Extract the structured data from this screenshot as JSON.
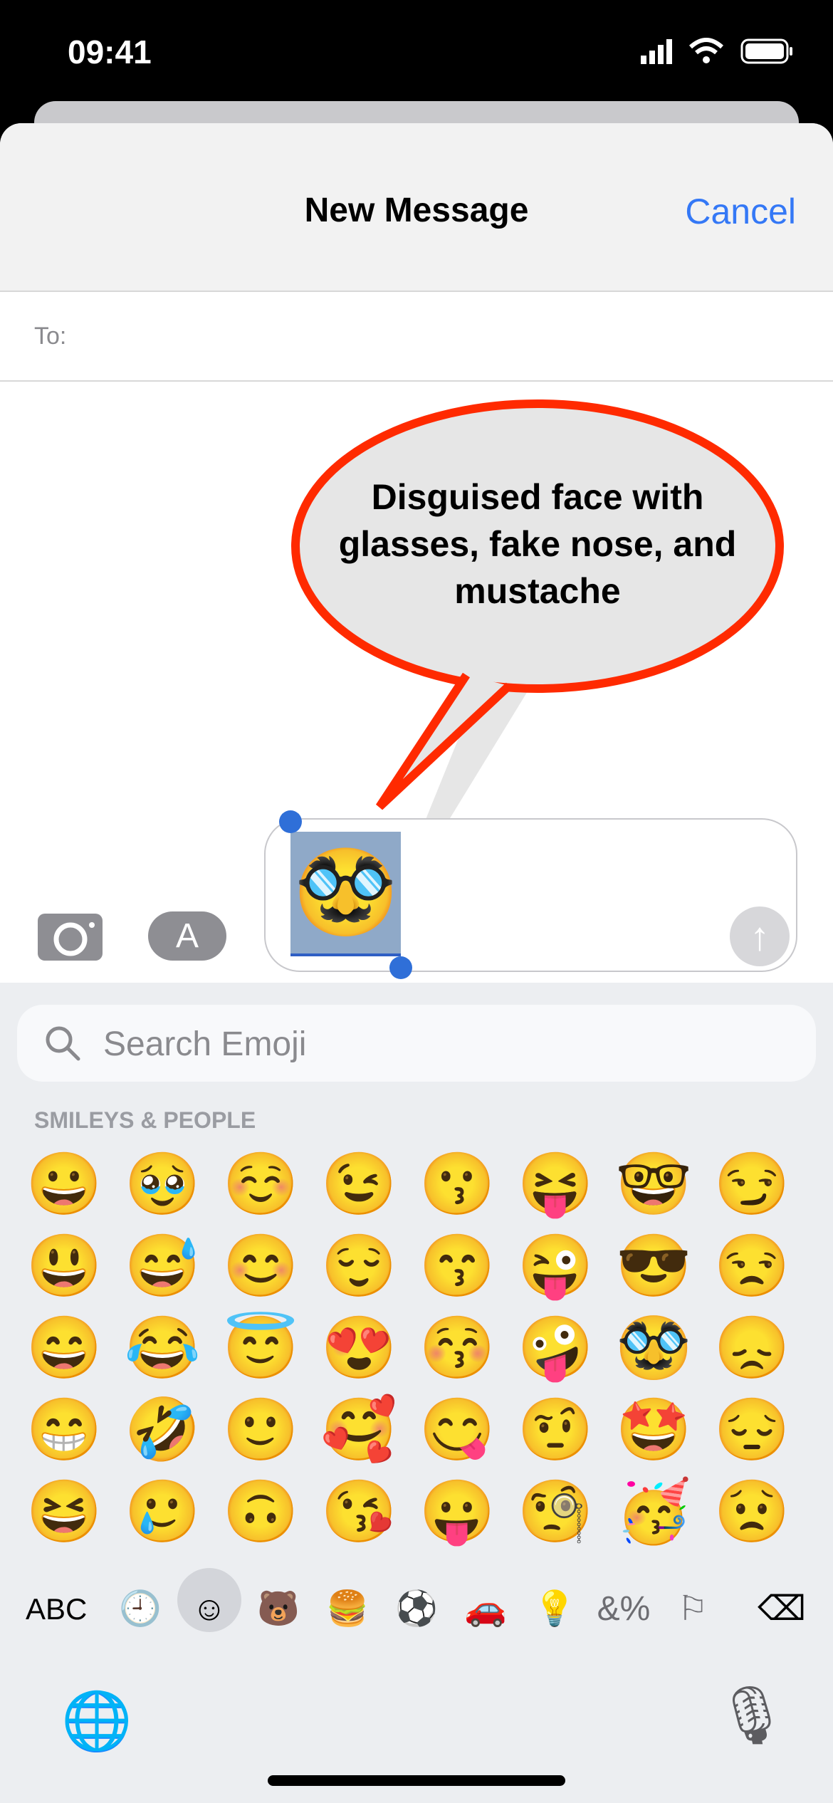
{
  "status_bar": {
    "time": "09:41",
    "signal": "cellular-signal-icon",
    "wifi": "wifi-icon",
    "battery": "battery-icon"
  },
  "header": {
    "title": "New Message",
    "cancel_label": "Cancel"
  },
  "recipient": {
    "label": "To:",
    "value": ""
  },
  "annotation": {
    "text": "Disguised face with glasses, fake nose, and mustache",
    "stroke_color": "#ff2a00",
    "fill_color": "#e6e6e6"
  },
  "composer": {
    "selected_emoji": "🥸",
    "selection_color": "#8fa9c8",
    "handle_color": "#2f6fd8",
    "send_icon": "arrow-up-icon"
  },
  "apps": {
    "camera_icon": "camera-icon",
    "appstore_icon": "app-store-icon"
  },
  "keyboard": {
    "search_placeholder": "Search Emoji",
    "section_title": "SMILEYS & PEOPLE",
    "emoji_rows": [
      [
        "😀",
        "🥹",
        "☺️",
        "😉",
        "😗",
        "😝",
        "🤓",
        "😏"
      ],
      [
        "😃",
        "😅",
        "😊",
        "😌",
        "😙",
        "😜",
        "😎",
        "😒"
      ],
      [
        "😄",
        "😂",
        "😇",
        "😍",
        "😚",
        "🤪",
        "🥸",
        "😞"
      ],
      [
        "😁",
        "🤣",
        "🙂",
        "🥰",
        "😋",
        "🤨",
        "🤩",
        "😔"
      ],
      [
        "😆",
        "🥲",
        "🙃",
        "😘",
        "😛",
        "🧐",
        "🥳",
        "😟"
      ]
    ],
    "abc_label": "ABC",
    "categories": [
      {
        "icon": "clock-icon",
        "glyph": "🕘"
      },
      {
        "icon": "smiley-icon",
        "glyph": "☺",
        "selected": true
      },
      {
        "icon": "bear-icon",
        "glyph": "🐻"
      },
      {
        "icon": "burger-icon",
        "glyph": "🍔"
      },
      {
        "icon": "soccer-ball-icon",
        "glyph": "⚽"
      },
      {
        "icon": "car-building-icon",
        "glyph": "🚗"
      },
      {
        "icon": "lightbulb-icon",
        "glyph": "💡"
      },
      {
        "icon": "symbols-icon",
        "glyph": "&%"
      },
      {
        "icon": "flag-icon",
        "glyph": "⚐"
      }
    ],
    "delete_glyph": "⌫",
    "globe_glyph": "🌐",
    "mic_glyph": "🎙"
  }
}
